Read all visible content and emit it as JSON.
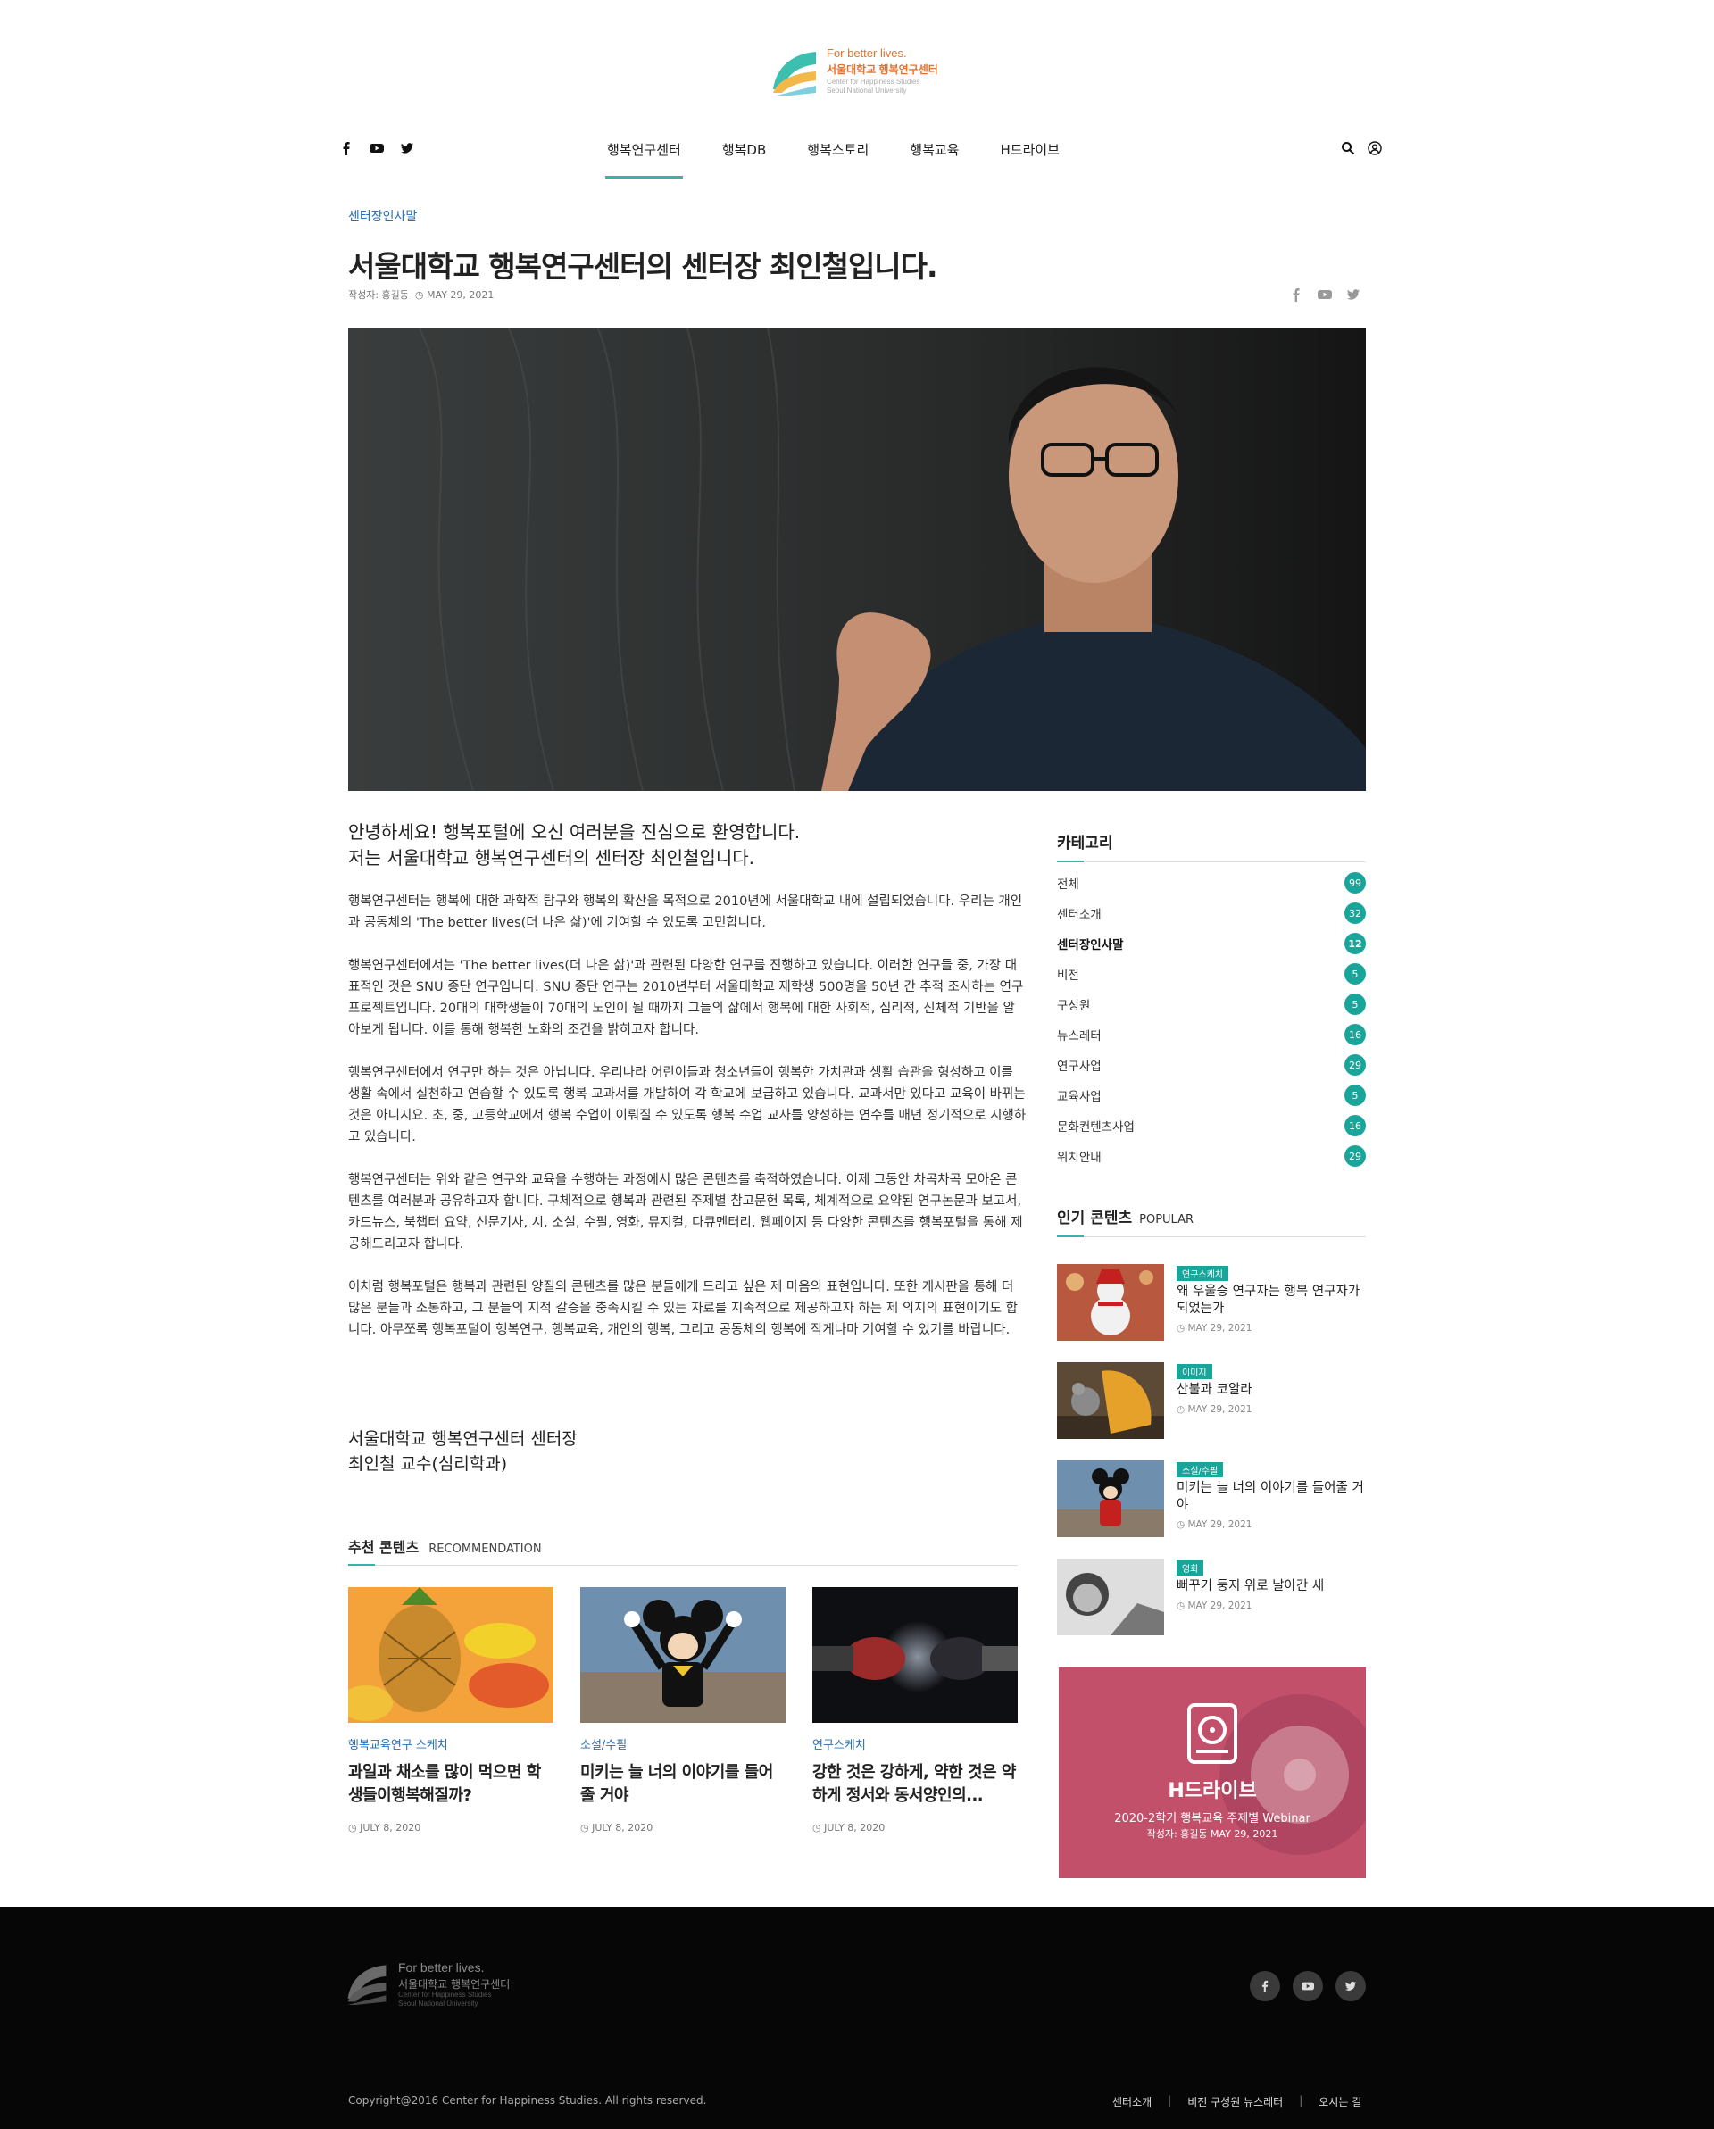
{
  "brand": {
    "tagline": "For better lives.",
    "name_kr": "서울대학교 행복연구센터",
    "name_en_1": "Center for Happiness Studies",
    "name_en_2": "Seoul National University"
  },
  "nav": {
    "items": [
      "행복연구센터",
      "행복DB",
      "행복스토리",
      "행복교육",
      "H드라이브"
    ],
    "active": 0
  },
  "article": {
    "category": "센터장인사말",
    "title": "서울대학교 행복연구센터의 센터장 최인철입니다.",
    "author_label": "작성자: 홍길동",
    "date": "MAY 29, 2021",
    "lead_1": "안녕하세요! 행복포털에 오신 여러분을 진심으로 환영합니다.",
    "lead_2": "저는 서울대학교 행복연구센터의 센터장 최인철입니다.",
    "paragraphs": [
      "행복연구센터는 행복에 대한 과학적 탐구와 행복의 확산을 목적으로 2010년에 서울대학교 내에 설립되었습니다. 우리는 개인과 공동체의 'The better lives(더 나은 삶)'에 기여할 수 있도록 고민합니다.",
      "행복연구센터에서는 'The better lives(더 나은 삶)'과 관련된 다양한 연구를 진행하고 있습니다. 이러한 연구들 중, 가장 대표적인 것은 SNU 종단 연구입니다. SNU 종단 연구는 2010년부터 서울대학교 재학생 500명을 50년 간 추적 조사하는 연구 프로젝트입니다. 20대의 대학생들이 70대의 노인이 될 때까지 그들의 삶에서 행복에 대한 사회적, 심리적, 신체적 기반을 알아보게 됩니다. 이를 통해 행복한 노화의 조건을 밝히고자 합니다.",
      "행복연구센터에서 연구만 하는 것은 아닙니다. 우리나라 어린이들과 청소년들이 행복한 가치관과 생활 습관을 형성하고 이를 생활 속에서 실천하고 연습할 수 있도록 행복 교과서를 개발하여 각 학교에 보급하고 있습니다. 교과서만 있다고 교육이 바뀌는 것은 아니지요. 초, 중, 고등학교에서 행복 수업이 이뤄질 수 있도록 행복 수업 교사를 양성하는 연수를 매년 정기적으로 시행하고 있습니다.",
      "행복연구센터는 위와 같은 연구와 교육을 수행하는 과정에서 많은 콘텐츠를 축적하였습니다. 이제 그동안 차곡차곡 모아온 콘텐츠를 여러분과 공유하고자 합니다. 구체적으로 행복과 관련된 주제별 참고문헌 목록, 체계적으로 요약된 연구논문과 보고서, 카드뉴스, 북챕터 요약, 신문기사, 시, 소설, 수필, 영화, 뮤지컬, 다큐멘터리, 웹페이지 등 다양한 콘텐츠를 행복포털을 통해 제공해드리고자 합니다.",
      "이처럼 행복포털은 행복과 관련된 양질의 콘텐츠를 많은 분들에게 드리고 싶은 제 마음의 표현입니다. 또한 게시판을 통해 더 많은 분들과 소통하고, 그 분들의 지적 갈증을 충족시킬 수 있는 자료를 지속적으로 제공하고자 하는 제 의지의 표현이기도 합니다. 아무쪼록 행복포털이 행복연구, 행복교육, 개인의 행복, 그리고 공동체의 행복에 작게나마 기여할 수 있기를 바랍니다."
    ],
    "sign_1": "서울대학교 행복연구센터 센터장",
    "sign_2": "최인철 교수(심리학과)"
  },
  "recommend": {
    "title": "추천 콘텐츠",
    "subtitle": "RECOMMENDATION",
    "cards": [
      {
        "category": "행복교육연구 스케치",
        "title": "과일과 채소를 많이 먹으면 학생들이행복해질까?",
        "date": "JULY 8, 2020"
      },
      {
        "category": "소설/수필",
        "title": "미키는 늘 너의 이야기를 들어줄 거야",
        "date": "JULY 8, 2020"
      },
      {
        "category": "연구스케치",
        "title": "강한 것은 강하게, 약한 것은 약하게 정서와 동서양인의...",
        "date": "JULY 8, 2020"
      }
    ]
  },
  "sidebar": {
    "cat_title": "카테고리",
    "categories": [
      {
        "label": "전체",
        "count": "99"
      },
      {
        "label": "센터소개",
        "count": "32"
      },
      {
        "label": "센터장인사말",
        "count": "12"
      },
      {
        "label": "비전",
        "count": "5"
      },
      {
        "label": "구성원",
        "count": "5"
      },
      {
        "label": "뉴스레터",
        "count": "16"
      },
      {
        "label": "연구사업",
        "count": "29"
      },
      {
        "label": "교육사업",
        "count": "5"
      },
      {
        "label": "문화컨텐츠사업",
        "count": "16"
      },
      {
        "label": "위치안내",
        "count": "29"
      }
    ],
    "pop_title": "인기 콘텐츠",
    "pop_sub": "POPULAR",
    "popular": [
      {
        "badge": "연구스케치",
        "title": "왜 우울증 연구자는 행복 연구자가 되었는가",
        "date": "MAY 29, 2021"
      },
      {
        "badge": "이미지",
        "title": "산불과 코알라",
        "date": "MAY 29, 2021"
      },
      {
        "badge": "소설/수필",
        "title": "미키는 늘 너의 이야기를 들어줄 거야",
        "date": "MAY 29, 2021"
      },
      {
        "badge": "영화",
        "title": "뻐꾸기 둥지 위로 날아간 새",
        "date": "MAY 29, 2021"
      }
    ],
    "banner": {
      "title": "H드라이브",
      "subtitle": "2020-2학기 행복교육 주제별 Webinar",
      "meta": "작성자: 홍길동  MAY 29, 2021"
    }
  },
  "footer": {
    "copyright": "Copyright@2016 Center for Happiness Studies. All rights reserved.",
    "links": [
      "센터소개",
      "비전 구성원 뉴스레터",
      "오시는 길"
    ]
  },
  "colors": {
    "accent": "#34b5a8",
    "count_badge": "#1aa59b",
    "link_blue": "#2a6fb8",
    "brand_orange": "#e8722c",
    "footer_bg": "#060606"
  }
}
